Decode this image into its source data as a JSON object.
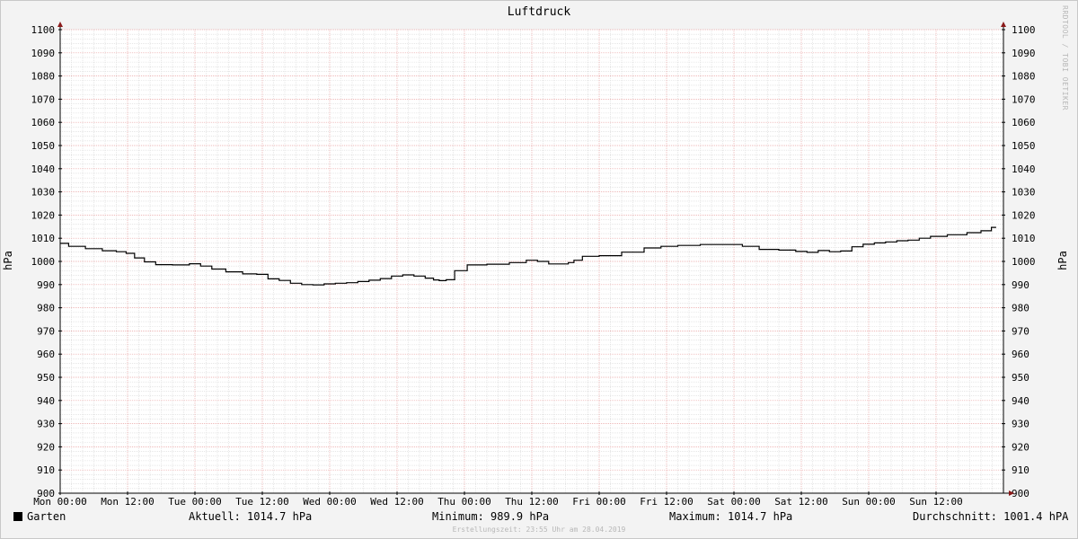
{
  "chart_data": {
    "type": "line",
    "title": "Luftdruck",
    "ylabel": "hPa",
    "ylabel_right": "hPa",
    "ylim": [
      900,
      1100
    ],
    "y_ticks": [
      900,
      910,
      920,
      930,
      940,
      950,
      960,
      970,
      980,
      990,
      1000,
      1010,
      1020,
      1030,
      1040,
      1050,
      1060,
      1070,
      1080,
      1090,
      1100
    ],
    "x_ticks": [
      {
        "label": "Mon 00:00",
        "hour": 0
      },
      {
        "label": "Mon 12:00",
        "hour": 12
      },
      {
        "label": "Tue 00:00",
        "hour": 24
      },
      {
        "label": "Tue 12:00",
        "hour": 36
      },
      {
        "label": "Wed 00:00",
        "hour": 48
      },
      {
        "label": "Wed 12:00",
        "hour": 60
      },
      {
        "label": "Thu 00:00",
        "hour": 72
      },
      {
        "label": "Thu 12:00",
        "hour": 84
      },
      {
        "label": "Fri 00:00",
        "hour": 96
      },
      {
        "label": "Fri 12:00",
        "hour": 108
      },
      {
        "label": "Sat 00:00",
        "hour": 120
      },
      {
        "label": "Sat 12:00",
        "hour": 132
      },
      {
        "label": "Sun 00:00",
        "hour": 144
      },
      {
        "label": "Sun 12:00",
        "hour": 156
      }
    ],
    "xlim": [
      0,
      168
    ],
    "grid": true,
    "series": [
      {
        "name": "Garten",
        "color": "#000000",
        "hours": [
          0,
          3,
          6,
          9,
          11,
          12.5,
          14,
          16,
          18,
          22,
          24,
          26,
          28,
          31,
          34,
          36,
          38,
          40,
          42,
          44,
          46,
          48,
          50,
          52,
          54,
          56,
          58,
          60,
          62,
          64,
          66,
          67,
          68,
          69.5,
          71,
          74,
          78,
          82,
          84,
          86,
          88,
          90,
          91,
          92,
          94,
          98,
          102,
          106,
          108,
          112,
          116,
          120,
          123,
          126,
          130,
          132,
          134,
          136,
          138,
          140,
          142,
          144,
          146,
          148,
          150,
          152,
          154,
          156,
          160,
          163,
          165,
          166.7
        ],
        "values": [
          1007.8,
          1006.5,
          1005.5,
          1004.6,
          1004.2,
          1003.5,
          1001.5,
          999.8,
          998.6,
          998.5,
          999.0,
          998.0,
          996.7,
          995.5,
          994.6,
          994.4,
          992.5,
          991.8,
          990.6,
          990.0,
          989.9,
          990.3,
          990.6,
          990.8,
          991.3,
          991.9,
          992.6,
          993.7,
          994.2,
          993.7,
          992.8,
          992.0,
          991.7,
          992.1,
          996.0,
          998.5,
          998.8,
          999.5,
          1000.5,
          1000.0,
          998.9,
          998.9,
          999.5,
          1000.5,
          1002.2,
          1002.5,
          1004.0,
          1005.8,
          1006.5,
          1006.9,
          1007.3,
          1007.3,
          1006.5,
          1005.2,
          1004.9,
          1004.3,
          1003.9,
          1004.7,
          1004.2,
          1004.5,
          1006.3,
          1007.4,
          1008.0,
          1008.4,
          1008.9,
          1009.2,
          1010.0,
          1010.8,
          1011.5,
          1012.4,
          1013.2,
          1014.7
        ]
      }
    ]
  },
  "legend": {
    "series_name": "Garten",
    "aktuell": "Aktuell: 1014.7 hPa",
    "minimum": "Minimum: 989.9 hPa",
    "maximum": "Maximum: 1014.7 hPa",
    "durchschnitt": "Durchschnitt: 1001.4 hPA"
  },
  "footer": "Erstellungszeit: 23:55 Uhr am 28.04.2019",
  "watermark": "RRDTOOL / TOBI OETIKER",
  "colors": {
    "background": "#f3f3f3",
    "plot_background": "#ffffff",
    "major_grid": "#e8a0a0",
    "minor_grid": "#d8d8d8",
    "axis": "#000000",
    "arrow": "#8b1a1a",
    "line": "#000000"
  }
}
